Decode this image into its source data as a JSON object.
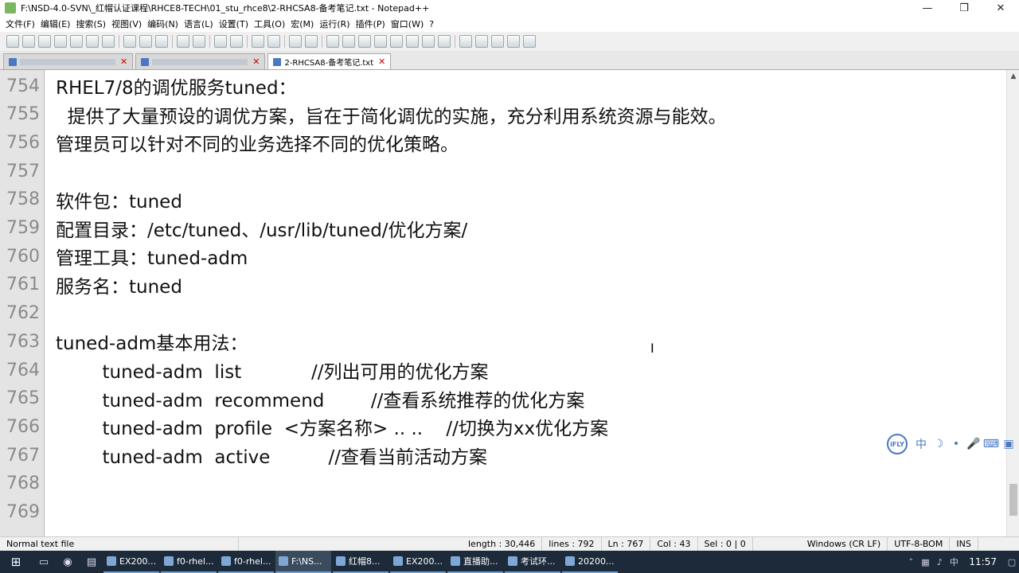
{
  "window": {
    "title": "F:\\NSD-4.0-SVN\\_红帽认证课程\\RHCE8-TECH\\01_stu_rhce8\\2-RHCSA8-备考笔记.txt - Notepad++",
    "minimize_icon": "minimize-icon",
    "maximize_icon": "maximize-icon",
    "close_icon": "close-icon"
  },
  "menu": [
    "文件(F)",
    "编辑(E)",
    "搜索(S)",
    "视图(V)",
    "编码(N)",
    "语言(L)",
    "设置(T)",
    "工具(O)",
    "宏(M)",
    "运行(R)",
    "插件(P)",
    "窗口(W)",
    "?"
  ],
  "tabs": [
    {
      "label": "",
      "active": false
    },
    {
      "label": "",
      "active": false
    },
    {
      "label": "2-RHCSA8-备考笔记.txt",
      "active": true
    }
  ],
  "editor": {
    "lines": [
      {
        "num": "754",
        "text": "RHEL7/8的调优服务tuned："
      },
      {
        "num": "755",
        "text": "  提供了大量预设的调优方案，旨在于简化调优的实施，充分利用系统资源与能效。"
      },
      {
        "num": "756",
        "text": "管理员可以针对不同的业务选择不同的优化策略。"
      },
      {
        "num": "757",
        "text": ""
      },
      {
        "num": "758",
        "text": "软件包：tuned"
      },
      {
        "num": "759",
        "text": "配置目录：/etc/tuned、/usr/lib/tuned/优化方案/"
      },
      {
        "num": "760",
        "text": "管理工具：tuned-adm"
      },
      {
        "num": "761",
        "text": "服务名：tuned"
      },
      {
        "num": "762",
        "text": ""
      },
      {
        "num": "763",
        "text": "tuned-adm基本用法："
      },
      {
        "num": "764",
        "text": "        tuned-adm  list            //列出可用的优化方案"
      },
      {
        "num": "765",
        "text": "        tuned-adm  recommend        //查看系统推荐的优化方案"
      },
      {
        "num": "766",
        "text": "        tuned-adm  profile  <方案名称> .. ..    //切换为xx优化方案"
      },
      {
        "num": "767",
        "text": "        tuned-adm  active          //查看当前活动方案"
      },
      {
        "num": "768",
        "text": ""
      },
      {
        "num": "769",
        "text": ""
      }
    ]
  },
  "status": {
    "file_type": "Normal text file",
    "length": "length : 30,446",
    "lines": "lines : 792",
    "ln": "Ln : 767",
    "col": "Col : 43",
    "sel": "Sel : 0 | 0",
    "eol": "Windows (CR LF)",
    "encoding": "UTF-8-BOM",
    "mode": "INS"
  },
  "ime": {
    "label": "iFLY",
    "lang": "中"
  },
  "taskbar": {
    "items": [
      "EX200...",
      "f0-rhel...",
      "f0-rhel...",
      "F:\\NS...",
      "红帽8...",
      "EX200...",
      "直播助...",
      "考试环...",
      "20200..."
    ],
    "active_index": 3,
    "clock": "11:57"
  }
}
